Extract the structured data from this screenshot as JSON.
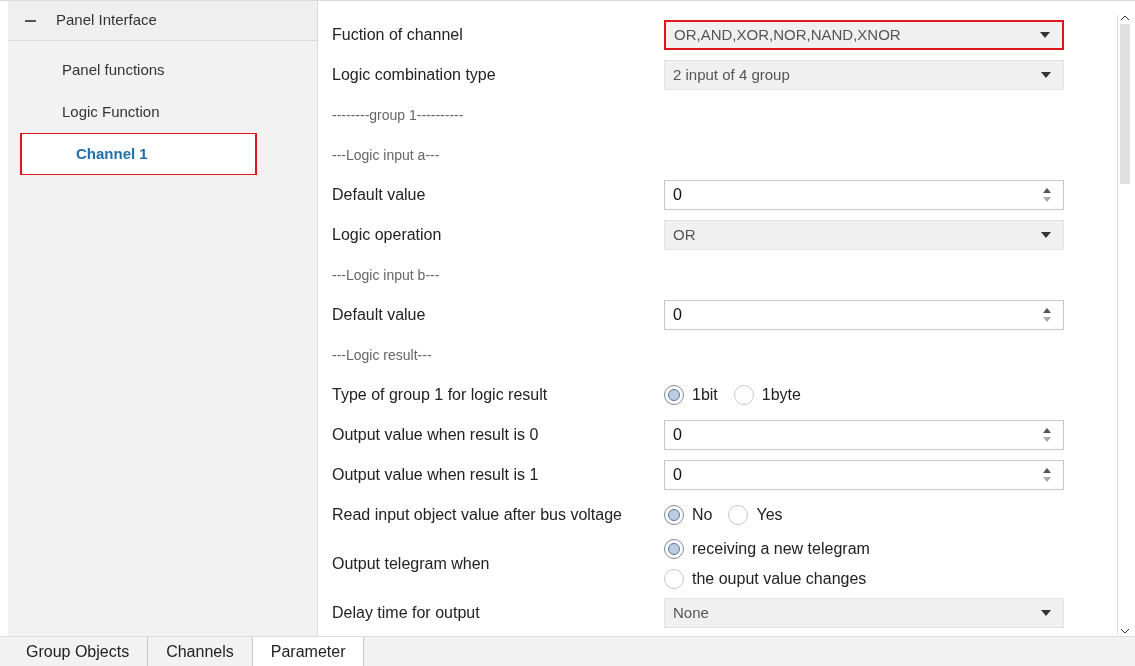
{
  "sidebar": {
    "group": {
      "label": "Panel Interface",
      "expanded": true,
      "children": [
        {
          "label": "Panel functions",
          "selected": false,
          "highlighted": false
        },
        {
          "label": "Logic Function",
          "selected": false,
          "highlighted": false
        },
        {
          "label": "Channel 1",
          "selected": true,
          "highlighted": true
        }
      ]
    }
  },
  "parameters": [
    {
      "kind": "select",
      "label": "Fuction of channel",
      "value": "OR,AND,XOR,NOR,NAND,XNOR",
      "highlighted": true
    },
    {
      "kind": "select",
      "label": "Logic combination type",
      "value": "2 input of 4 group",
      "highlighted": false
    },
    {
      "kind": "heading",
      "label": "--------group 1----------"
    },
    {
      "kind": "heading",
      "label": "---Logic input a---"
    },
    {
      "kind": "number",
      "label": "Default value",
      "value": "0",
      "highlighted": false
    },
    {
      "kind": "select",
      "label": "Logic operation",
      "value": "OR",
      "highlighted": false
    },
    {
      "kind": "heading",
      "label": "---Logic input b---"
    },
    {
      "kind": "number",
      "label": "Default value",
      "value": "0",
      "highlighted": false
    },
    {
      "kind": "heading",
      "label": "---Logic result---"
    },
    {
      "kind": "radio",
      "label": "Type of group 1 for logic result",
      "options": [
        {
          "label": "1bit",
          "selected": true
        },
        {
          "label": "1byte",
          "selected": false
        }
      ]
    },
    {
      "kind": "number",
      "label": "Output value when result is 0",
      "value": "0",
      "highlighted": false
    },
    {
      "kind": "number",
      "label": "Output value when result is 1",
      "value": "0",
      "highlighted": false
    },
    {
      "kind": "radio",
      "label": "Read input object value after bus voltage",
      "options": [
        {
          "label": "No",
          "selected": true
        },
        {
          "label": "Yes",
          "selected": false
        }
      ]
    },
    {
      "kind": "radio-stacked",
      "label": "Output telegram when",
      "options": [
        {
          "label": "receiving a new telegram",
          "selected": true
        },
        {
          "label": "the ouput value changes",
          "selected": false
        }
      ]
    },
    {
      "kind": "select",
      "label": "Delay time for output",
      "value": "None",
      "highlighted": false
    }
  ],
  "tabs": [
    {
      "label": "Group Objects",
      "selected": false
    },
    {
      "label": "Channels",
      "selected": false
    },
    {
      "label": "Parameter",
      "selected": true
    }
  ]
}
